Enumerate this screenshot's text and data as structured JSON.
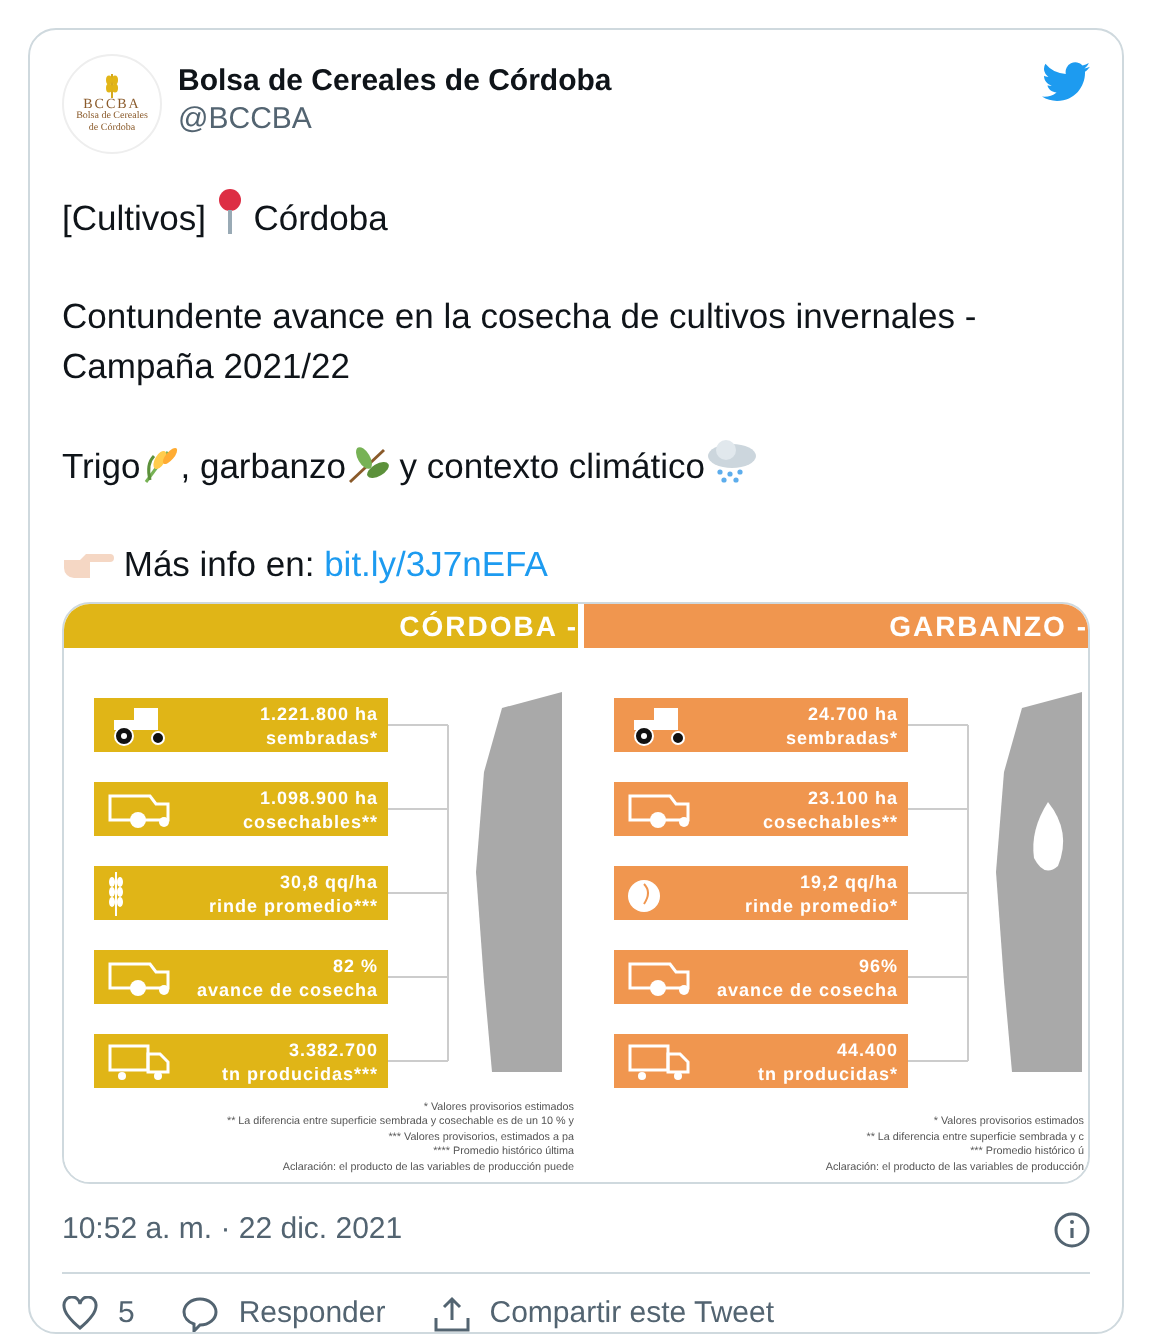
{
  "author": {
    "name": "Bolsa de Cereales de Córdoba",
    "handle": "@BCCBA",
    "avatar_text": "BCCBA",
    "avatar_subtext": "Bolsa de Cereales de Córdoba"
  },
  "text": {
    "tag": "[Cultivos]",
    "place": "Córdoba",
    "headline": "Contundente avance en la cosecha de cultivos invernales - Campaña 2021/22",
    "crop_1": "Trigo",
    "crop_2": ", garbanzo",
    "rest": " y contexto climático",
    "prompt": "Más info en:",
    "link": "bit.ly/3J7nEFA"
  },
  "infographic": {
    "panels": [
      {
        "title": "CÓRDOBA -",
        "color": "#e0b517",
        "rows": [
          {
            "kind": "sown",
            "value": "1.221.800 ha",
            "label": "sembradas*"
          },
          {
            "kind": "harvestable",
            "value": "1.098.900 ha",
            "label": "cosechables**"
          },
          {
            "kind": "yield",
            "value": "30,8 qq/ha",
            "label": "rinde promedio***"
          },
          {
            "kind": "progress",
            "value": "82 %",
            "label": "avance de cosecha"
          },
          {
            "kind": "production",
            "value": "3.382.700",
            "label": "tn producidas***"
          }
        ],
        "footnotes": [
          "* Valores provisorios estimados",
          "** La diferencia entre superficie sembrada y cosechable es de un 10 % y",
          "*** Valores provisorios, estimados a pa",
          "**** Promedio histórico última",
          "Aclaración: el producto de las variables de producción puede"
        ]
      },
      {
        "title": "GARBANZO -",
        "color": "#f0964f",
        "rows": [
          {
            "kind": "sown",
            "value": "24.700 ha",
            "label": "sembradas*"
          },
          {
            "kind": "harvestable",
            "value": "23.100 ha",
            "label": "cosechables**"
          },
          {
            "kind": "yield",
            "value": "19,2 qq/ha",
            "label": "rinde promedio*"
          },
          {
            "kind": "progress",
            "value": "96%",
            "label": "avance de cosecha"
          },
          {
            "kind": "production",
            "value": "44.400",
            "label": "tn producidas*"
          }
        ],
        "footnotes": [
          "* Valores provisorios estimados",
          "** La diferencia entre superficie sembrada y c",
          "*** Promedio histórico ú",
          "Aclaración: el producto de las variables de producción"
        ]
      }
    ]
  },
  "timestamp": "10:52 a. m. · 22 dic. 2021",
  "actions": {
    "likes": "5",
    "reply": "Responder",
    "share": "Compartir este Tweet"
  }
}
